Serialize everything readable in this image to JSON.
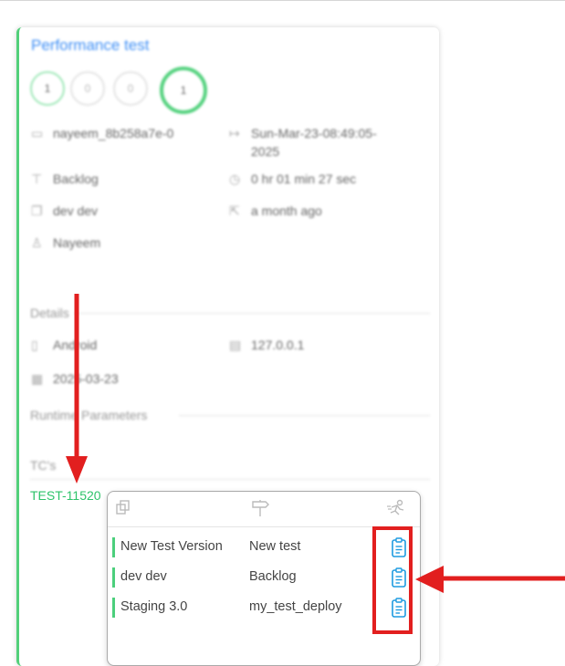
{
  "card": {
    "title": "Performance test",
    "circles": [
      "1",
      "0",
      "0",
      "1"
    ],
    "meta": {
      "user_id": "nayeem_8b258a7e-0",
      "date_line1": "Sun-Mar-23-08:49:05-",
      "date_line2": "2025",
      "status": "Backlog",
      "duration": "0 hr 01 min 27 sec",
      "version": "dev dev",
      "ago": "a month ago",
      "owner": "Nayeem"
    },
    "details_label": "Details",
    "details": {
      "platform": "Android",
      "ip": "127.0.0.1",
      "date": "2025-03-23"
    },
    "runtime_label": "Runtime Parameters",
    "tcs_label": "TC's",
    "tc_link": "TEST-11520"
  },
  "popup": {
    "header_icons": [
      "copy-icon",
      "signpost-icon",
      "runner-icon"
    ],
    "rows": [
      {
        "version": "New Test Version",
        "status": "New test"
      },
      {
        "version": "dev dev",
        "status": "Backlog"
      },
      {
        "version": "Staging 3.0",
        "status": "my_test_deploy"
      }
    ]
  },
  "colors": {
    "accent_green": "#4ccf7c",
    "title_blue": "#3f8ff5",
    "annotation_red": "#e21f1f",
    "clipboard_blue": "#1e9be0"
  }
}
